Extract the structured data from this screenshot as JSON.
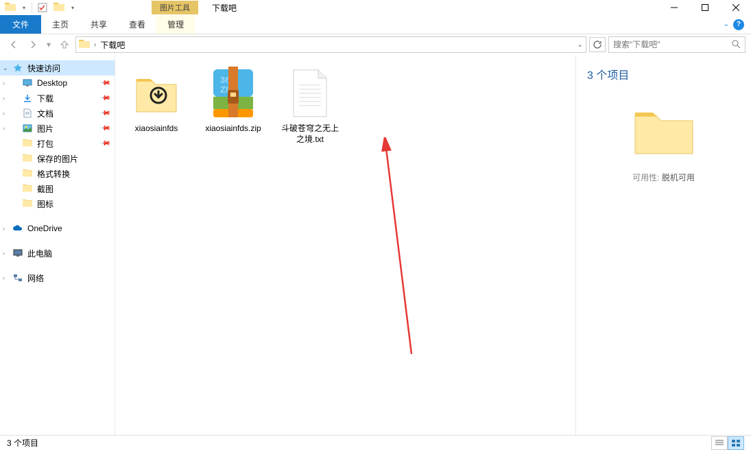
{
  "window": {
    "contextual_tab": "图片工具",
    "title": "下载吧"
  },
  "ribbon": {
    "file": "文件",
    "home": "主页",
    "share": "共享",
    "view": "查看",
    "manage": "管理"
  },
  "address": {
    "path": "下载吧",
    "search_placeholder": "搜索\"下载吧\""
  },
  "sidebar": {
    "quick_access": "快速访问",
    "items": [
      {
        "label": "Desktop",
        "pinned": true
      },
      {
        "label": "下载",
        "pinned": true
      },
      {
        "label": "文档",
        "pinned": true
      },
      {
        "label": "图片",
        "pinned": true
      },
      {
        "label": "打包",
        "pinned": true
      },
      {
        "label": "保存的图片"
      },
      {
        "label": "格式转换"
      },
      {
        "label": "截图"
      },
      {
        "label": "图标"
      }
    ],
    "onedrive": "OneDrive",
    "this_pc": "此电脑",
    "network": "网络"
  },
  "files": [
    {
      "name": "xiaosiainfds",
      "type": "folder"
    },
    {
      "name": "xiaosiainfds.zip",
      "type": "zip"
    },
    {
      "name": "斗破苍穹之无上之境.txt",
      "type": "txt"
    }
  ],
  "details": {
    "title": "3 个项目",
    "availability_label": "可用性:",
    "availability_value": "脱机可用"
  },
  "status": {
    "text": "3 个项目"
  }
}
